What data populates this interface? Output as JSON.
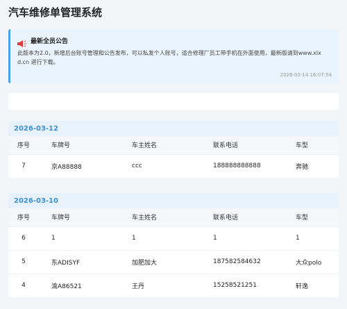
{
  "app": {
    "title": "汽车维修单管理系统"
  },
  "notice": {
    "icon": "megaphone-icon",
    "title": "最新全员公告",
    "body": "此版本为2.0，新增后台账号管理和公告发布，可以私发个人账号，适合修理厂员工带手机在外面使用，最新版请到www.xlxd.cn 进行下载。",
    "time": "2026-03-14 16:07:54"
  },
  "table_headers": {
    "no": "序号",
    "plate": "车牌号",
    "owner": "车主姓名",
    "phone": "联系电话",
    "model": "车型"
  },
  "groups": [
    {
      "date": "2026-03-12",
      "rows": [
        {
          "no": "7",
          "plate": "京A88888",
          "owner": "ccc",
          "phone": "188888888888",
          "model": "奔驰"
        }
      ]
    },
    {
      "date": "2026-03-10",
      "rows": [
        {
          "no": "6",
          "plate": "1",
          "owner": "1",
          "phone": "1",
          "model": "1"
        },
        {
          "no": "5",
          "plate": "东ADISYF",
          "owner": "加肥加大",
          "phone": "187582584632",
          "model": "大众polo"
        },
        {
          "no": "4",
          "plate": "渝A86521",
          "owner": "王丹",
          "phone": "15258521251",
          "model": "轩逸"
        }
      ]
    }
  ],
  "colors": {
    "accent": "#3a8fd6",
    "notice_bg": "#eaf4fd",
    "notice_border": "#4aa3e8",
    "page_bg": "#f3f5f8"
  }
}
